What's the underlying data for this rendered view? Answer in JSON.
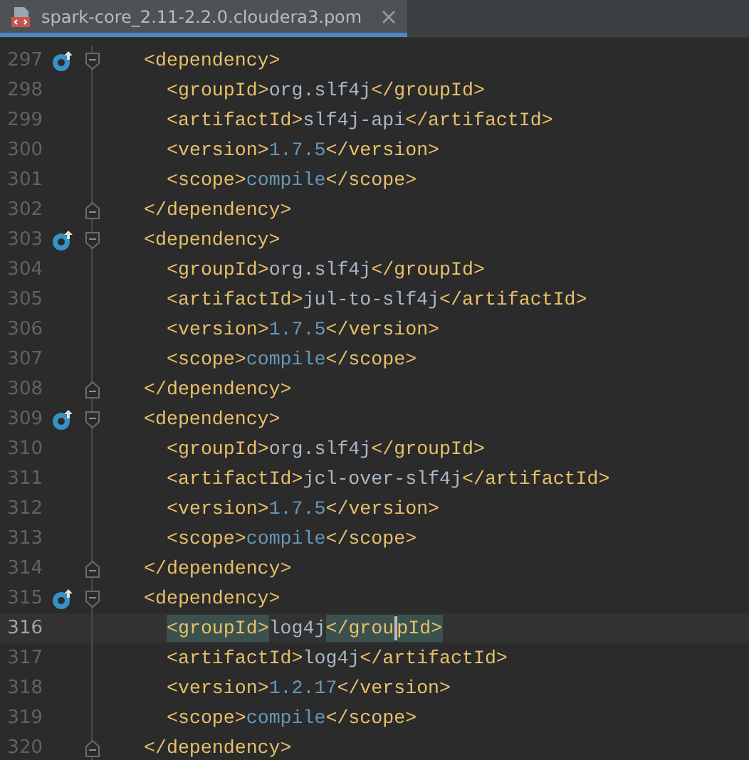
{
  "tab": {
    "title": "spark-core_2.11-2.2.0.cloudera3.pom",
    "selected": true
  },
  "blocks": [
    {
      "open": {
        "number": "297",
        "marker": true,
        "current": false,
        "segments": [
          {
            "kind": "tag",
            "text": "<dependency>"
          }
        ]
      },
      "close": {
        "number": "302",
        "current": false,
        "segments": [
          {
            "kind": "tag",
            "text": "</dependency>"
          }
        ]
      },
      "children": [
        {
          "number": "298",
          "current": false,
          "segments": [
            {
              "kind": "tag",
              "text": "<groupId>"
            },
            {
              "kind": "text",
              "text": "org.slf4j"
            },
            {
              "kind": "tag",
              "text": "</groupId>"
            }
          ]
        },
        {
          "number": "299",
          "current": false,
          "segments": [
            {
              "kind": "tag",
              "text": "<artifactId>"
            },
            {
              "kind": "text",
              "text": "slf4j-api"
            },
            {
              "kind": "tag",
              "text": "</artifactId>"
            }
          ]
        },
        {
          "number": "300",
          "current": false,
          "segments": [
            {
              "kind": "tag",
              "text": "<version>"
            },
            {
              "kind": "value",
              "text": "1.7.5"
            },
            {
              "kind": "tag",
              "text": "</version>"
            }
          ]
        },
        {
          "number": "301",
          "current": false,
          "segments": [
            {
              "kind": "tag",
              "text": "<scope>"
            },
            {
              "kind": "value",
              "text": "compile"
            },
            {
              "kind": "tag",
              "text": "</scope>"
            }
          ]
        }
      ]
    },
    {
      "open": {
        "number": "303",
        "marker": true,
        "current": false,
        "segments": [
          {
            "kind": "tag",
            "text": "<dependency>"
          }
        ]
      },
      "close": {
        "number": "308",
        "current": false,
        "segments": [
          {
            "kind": "tag",
            "text": "</dependency>"
          }
        ]
      },
      "children": [
        {
          "number": "304",
          "current": false,
          "segments": [
            {
              "kind": "tag",
              "text": "<groupId>"
            },
            {
              "kind": "text",
              "text": "org.slf4j"
            },
            {
              "kind": "tag",
              "text": "</groupId>"
            }
          ]
        },
        {
          "number": "305",
          "current": false,
          "segments": [
            {
              "kind": "tag",
              "text": "<artifactId>"
            },
            {
              "kind": "text",
              "text": "jul-to-slf4j"
            },
            {
              "kind": "tag",
              "text": "</artifactId>"
            }
          ]
        },
        {
          "number": "306",
          "current": false,
          "segments": [
            {
              "kind": "tag",
              "text": "<version>"
            },
            {
              "kind": "value",
              "text": "1.7.5"
            },
            {
              "kind": "tag",
              "text": "</version>"
            }
          ]
        },
        {
          "number": "307",
          "current": false,
          "segments": [
            {
              "kind": "tag",
              "text": "<scope>"
            },
            {
              "kind": "value",
              "text": "compile"
            },
            {
              "kind": "tag",
              "text": "</scope>"
            }
          ]
        }
      ]
    },
    {
      "open": {
        "number": "309",
        "marker": true,
        "current": false,
        "segments": [
          {
            "kind": "tag",
            "text": "<dependency>"
          }
        ]
      },
      "close": {
        "number": "314",
        "current": false,
        "segments": [
          {
            "kind": "tag",
            "text": "</dependency>"
          }
        ]
      },
      "children": [
        {
          "number": "310",
          "current": false,
          "segments": [
            {
              "kind": "tag",
              "text": "<groupId>"
            },
            {
              "kind": "text",
              "text": "org.slf4j"
            },
            {
              "kind": "tag",
              "text": "</groupId>"
            }
          ]
        },
        {
          "number": "311",
          "current": false,
          "segments": [
            {
              "kind": "tag",
              "text": "<artifactId>"
            },
            {
              "kind": "text",
              "text": "jcl-over-slf4j"
            },
            {
              "kind": "tag",
              "text": "</artifactId>"
            }
          ]
        },
        {
          "number": "312",
          "current": false,
          "segments": [
            {
              "kind": "tag",
              "text": "<version>"
            },
            {
              "kind": "value",
              "text": "1.7.5"
            },
            {
              "kind": "tag",
              "text": "</version>"
            }
          ]
        },
        {
          "number": "313",
          "current": false,
          "segments": [
            {
              "kind": "tag",
              "text": "<scope>"
            },
            {
              "kind": "value",
              "text": "compile"
            },
            {
              "kind": "tag",
              "text": "</scope>"
            }
          ]
        }
      ]
    },
    {
      "open": {
        "number": "315",
        "marker": true,
        "current": false,
        "segments": [
          {
            "kind": "tag",
            "text": "<dependency>"
          }
        ]
      },
      "close": {
        "number": "320",
        "current": false,
        "segments": [
          {
            "kind": "tag",
            "text": "</dependency>"
          }
        ]
      },
      "children": [
        {
          "number": "316",
          "current": true,
          "segments": [
            {
              "kind": "tag",
              "text": "<groupId>",
              "matched": true
            },
            {
              "kind": "text",
              "text": "log4j"
            },
            {
              "kind": "tag",
              "text": "</grou",
              "matched": true
            },
            {
              "kind": "caret"
            },
            {
              "kind": "tag",
              "text": "pId>",
              "matched": true
            }
          ]
        },
        {
          "number": "317",
          "current": false,
          "segments": [
            {
              "kind": "tag",
              "text": "<artifactId>"
            },
            {
              "kind": "text",
              "text": "log4j"
            },
            {
              "kind": "tag",
              "text": "</artifactId>"
            }
          ]
        },
        {
          "number": "318",
          "current": false,
          "segments": [
            {
              "kind": "tag",
              "text": "<version>"
            },
            {
              "kind": "value",
              "text": "1.2.17"
            },
            {
              "kind": "tag",
              "text": "</version>"
            }
          ]
        },
        {
          "number": "319",
          "current": false,
          "segments": [
            {
              "kind": "tag",
              "text": "<scope>"
            },
            {
              "kind": "value",
              "text": "compile"
            },
            {
              "kind": "tag",
              "text": "</scope>"
            }
          ]
        }
      ]
    }
  ]
}
